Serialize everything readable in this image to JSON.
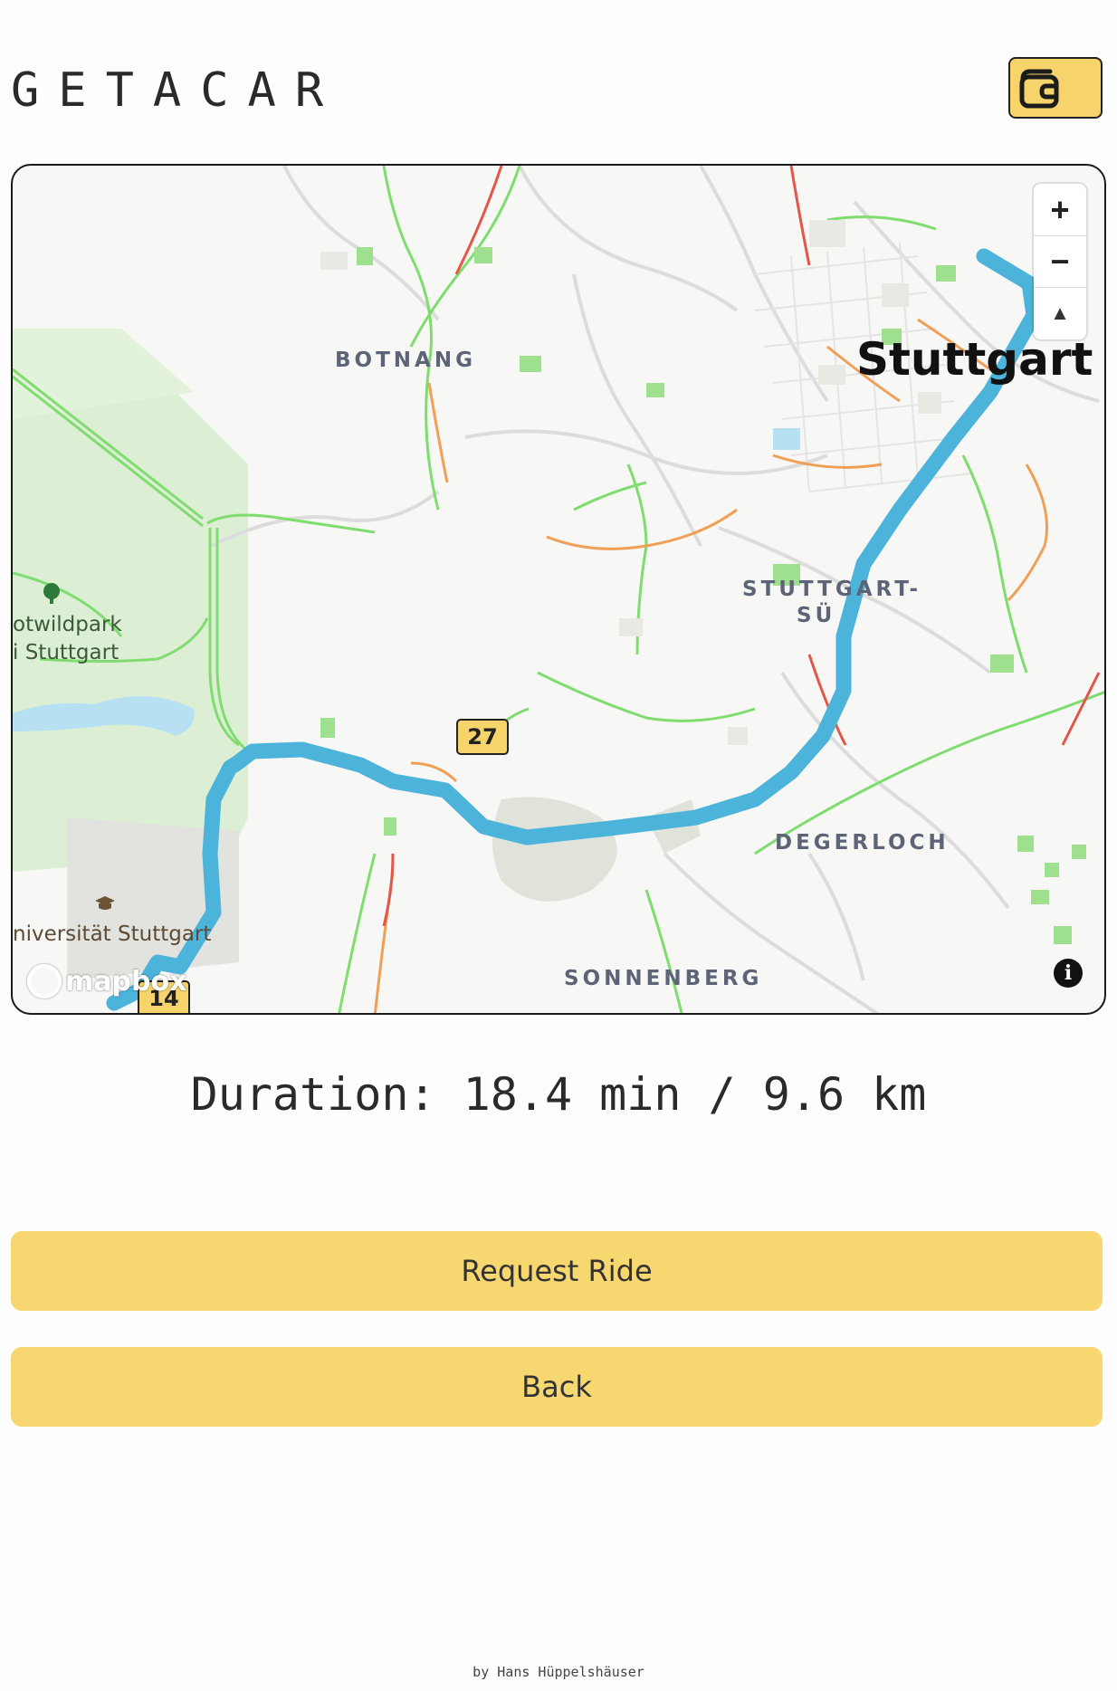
{
  "app": {
    "brand": "GETACAR",
    "wallet_icon": "wallet-icon",
    "accent_color": "#f7d870"
  },
  "map": {
    "labels": {
      "botnang": "BOTNANG",
      "stuttgart": "Stuttgart",
      "stuttgart_sud_line1": "STUTTGART-",
      "stuttgart_sud_line2": "SÜ",
      "degerloch": "DEGERLOCH",
      "sonnenberg": "SONNENBERG",
      "park_line1": "otwildpark",
      "park_line2": "i Stuttgart",
      "university": "niversität Stuttgart"
    },
    "shields": {
      "route_14": "14",
      "route_27": "27"
    },
    "controls": {
      "zoom_in": "+",
      "zoom_out": "−",
      "compass": "▲"
    },
    "attribution": {
      "logo_text": "mapbox",
      "info": "i"
    },
    "route_color": "#4cb3db"
  },
  "trip": {
    "duration": "Duration: 18.4 min / 9.6 km"
  },
  "actions": {
    "request_ride": "Request Ride",
    "back": "Back"
  },
  "footer": {
    "credit": "by Hans Hüppelshäuser"
  }
}
